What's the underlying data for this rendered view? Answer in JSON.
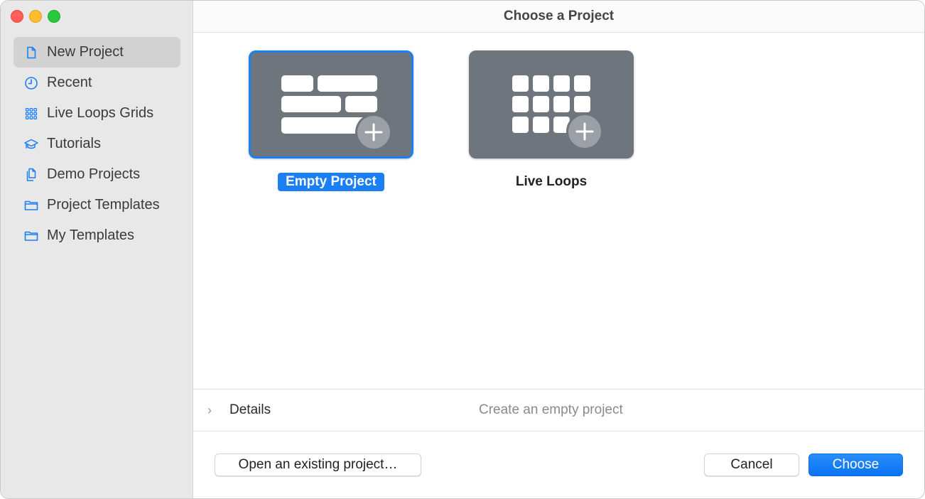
{
  "window": {
    "title": "Choose a Project",
    "traffic_lights": [
      "close",
      "minimize",
      "zoom"
    ]
  },
  "sidebar": {
    "items": [
      {
        "label": "New Project",
        "icon": "document-icon",
        "selected": true
      },
      {
        "label": "Recent",
        "icon": "clock-icon",
        "selected": false
      },
      {
        "label": "Live Loops Grids",
        "icon": "grid-icon",
        "selected": false
      },
      {
        "label": "Tutorials",
        "icon": "graduation-cap-icon",
        "selected": false
      },
      {
        "label": "Demo Projects",
        "icon": "documents-icon",
        "selected": false
      },
      {
        "label": "Project Templates",
        "icon": "folder-icon",
        "selected": false
      },
      {
        "label": "My Templates",
        "icon": "folder-icon",
        "selected": false
      }
    ]
  },
  "tiles": [
    {
      "label": "Empty Project",
      "icon": "tracks-add-icon",
      "selected": true
    },
    {
      "label": "Live Loops",
      "icon": "loops-grid-add-icon",
      "selected": false
    }
  ],
  "details": {
    "label": "Details",
    "description": "Create an empty project",
    "expanded": false
  },
  "buttons": {
    "open_existing": "Open an existing project…",
    "cancel": "Cancel",
    "choose": "Choose"
  },
  "colors": {
    "accent": "#1a7ef5",
    "sidebar_bg": "#e8e8e8",
    "tile_bg": "#6e757c"
  }
}
